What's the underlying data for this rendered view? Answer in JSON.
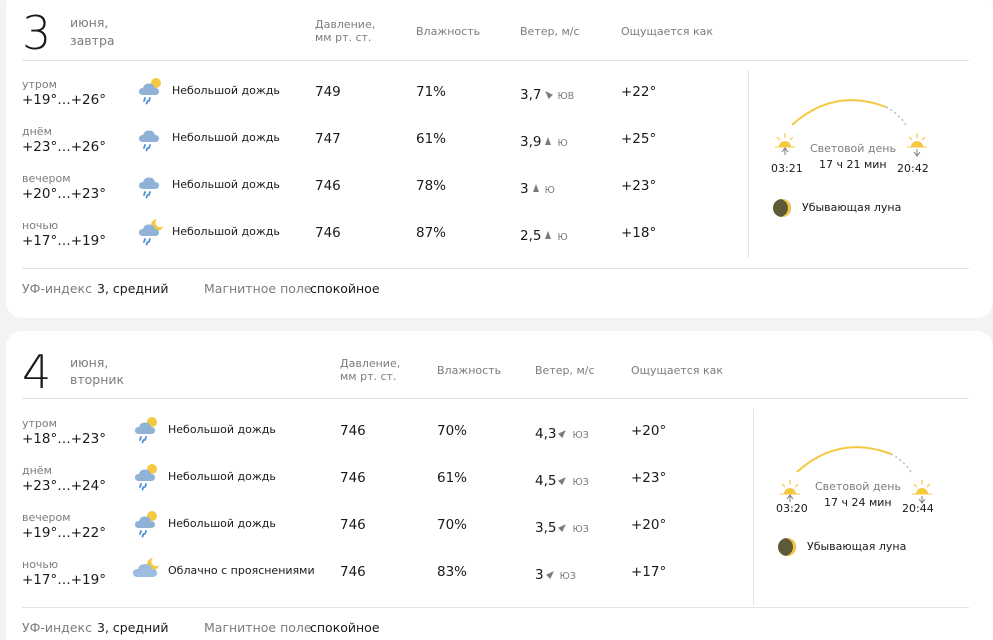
{
  "day1": {
    "number": "3",
    "month": "июня,",
    "weekday": "завтра",
    "headers": {
      "pressure_1": "Давление,",
      "pressure_2": "мм рт. ст.",
      "humidity": "Влажность",
      "wind": "Ветер, м/с",
      "feels": "Ощущается как"
    },
    "rows": [
      {
        "period": "утром",
        "temp": "+19°…+26°",
        "icon": "cloud-sun-rain-icon",
        "condition": "Небольшой дождь",
        "pressure": "749",
        "humidity": "71%",
        "wind": "3,7",
        "wind_dir": "ЮВ",
        "wind_deg": 135,
        "feels": "+22°"
      },
      {
        "period": "днём",
        "temp": "+23°…+26°",
        "icon": "cloud-rain-icon",
        "condition": "Небольшой дождь",
        "pressure": "747",
        "humidity": "61%",
        "wind": "3,9",
        "wind_dir": "Ю",
        "wind_deg": 180,
        "feels": "+25°"
      },
      {
        "period": "вечером",
        "temp": "+20°…+23°",
        "icon": "cloud-rain-icon",
        "condition": "Небольшой дождь",
        "pressure": "746",
        "humidity": "78%",
        "wind": "3",
        "wind_dir": "Ю",
        "wind_deg": 180,
        "feels": "+23°"
      },
      {
        "period": "ночью",
        "temp": "+17°…+19°",
        "icon": "cloud-moon-rain-icon",
        "condition": "Небольшой дождь",
        "pressure": "746",
        "humidity": "87%",
        "wind": "2,5",
        "wind_dir": "Ю",
        "wind_deg": 180,
        "feels": "+18°"
      }
    ],
    "sun": {
      "sunrise": "03:21",
      "sunset": "20:42",
      "daylight_label": "Световой день",
      "daylight": "17 ч 21 мин"
    },
    "moon": "Убывающая луна",
    "uv_label": "УФ-индекс",
    "uv_value": "3, средний",
    "magnetic_label": "Магнитное поле",
    "magnetic_value": "спокойное"
  },
  "day2": {
    "number": "4",
    "month": "июня,",
    "weekday": "вторник",
    "headers": {
      "pressure_1": "Давление,",
      "pressure_2": "мм рт. ст.",
      "humidity": "Влажность",
      "wind": "Ветер, м/с",
      "feels": "Ощущается как"
    },
    "rows": [
      {
        "period": "утром",
        "temp": "+18°…+23°",
        "icon": "cloud-sun-rain-icon",
        "condition": "Небольшой дождь",
        "pressure": "746",
        "humidity": "70%",
        "wind": "4,3",
        "wind_dir": "ЮЗ",
        "wind_deg": 225,
        "feels": "+20°"
      },
      {
        "period": "днём",
        "temp": "+23°…+24°",
        "icon": "cloud-sun-rain-icon",
        "condition": "Небольшой дождь",
        "pressure": "746",
        "humidity": "61%",
        "wind": "4,5",
        "wind_dir": "ЮЗ",
        "wind_deg": 225,
        "feels": "+23°"
      },
      {
        "period": "вечером",
        "temp": "+19°…+22°",
        "icon": "cloud-sun-rain-icon",
        "condition": "Небольшой дождь",
        "pressure": "746",
        "humidity": "70%",
        "wind": "3,5",
        "wind_dir": "ЮЗ",
        "wind_deg": 225,
        "feels": "+20°"
      },
      {
        "period": "ночью",
        "temp": "+17°…+19°",
        "icon": "cloud-moon-icon",
        "condition": "Облачно с прояснениями",
        "pressure": "746",
        "humidity": "83%",
        "wind": "3",
        "wind_dir": "ЮЗ",
        "wind_deg": 225,
        "feels": "+17°"
      }
    ],
    "sun": {
      "sunrise": "03:20",
      "sunset": "20:44",
      "daylight_label": "Световой день",
      "daylight": "17 ч 24 мин"
    },
    "moon": "Убывающая луна",
    "uv_label": "УФ-индекс",
    "uv_value": "3, средний",
    "magnetic_label": "Магнитное поле",
    "magnetic_value": "спокойное"
  },
  "colors": {
    "card": "#ffffff",
    "background": "#f2f3f5",
    "text": "#1a1a1a",
    "muted": "#7c7c7c",
    "sun": "#f4c940",
    "cloud": "#8fb2d6",
    "rain": "#4a90d9",
    "moon": "#5c5a38"
  }
}
